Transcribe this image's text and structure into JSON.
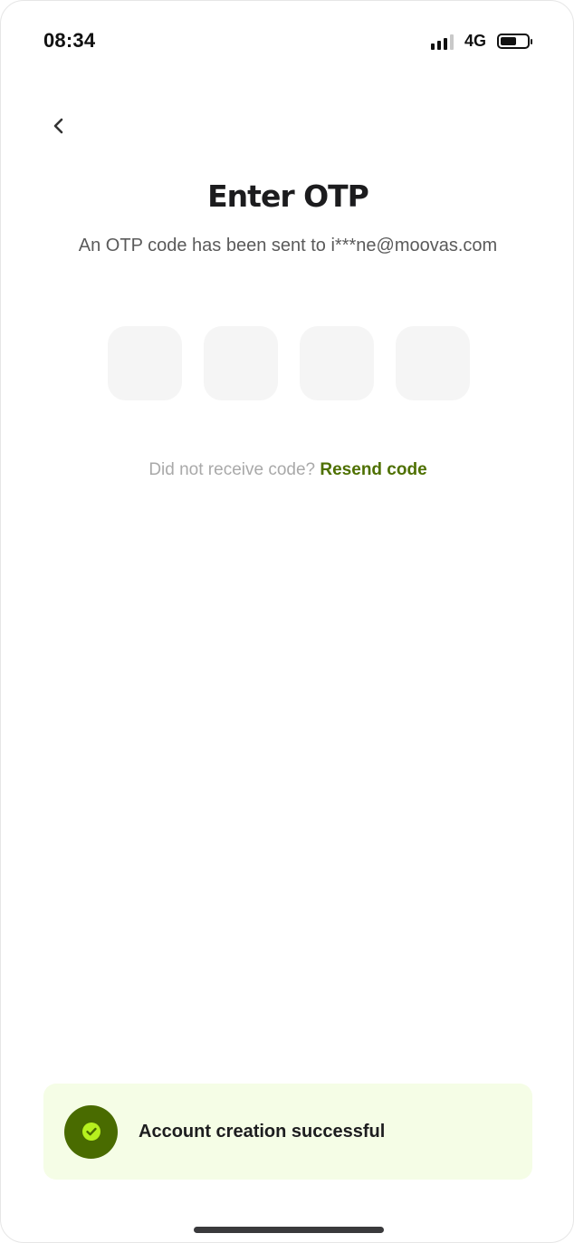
{
  "status_bar": {
    "time": "08:34",
    "network": "4G",
    "signal_icon": "cellular-signal-icon",
    "battery_icon": "battery-icon",
    "battery_level": 0.6
  },
  "header": {
    "back_icon": "chevron-left-icon"
  },
  "main": {
    "title": "Enter OTP",
    "subtitle": "An OTP code has been sent to i***ne@moovas.com",
    "otp_fields": [
      "",
      "",
      "",
      ""
    ],
    "resend_prompt": "Did not receive code?",
    "resend_link": "Resend code"
  },
  "toast": {
    "icon": "check-circle-icon",
    "message": "Account creation successful"
  },
  "colors": {
    "accent": "#4e7000",
    "toast_bg": "#f5fde6",
    "toast_icon_bg": "#496b00",
    "check_color": "#b6f01e",
    "otp_box_bg": "#f5f5f5"
  }
}
